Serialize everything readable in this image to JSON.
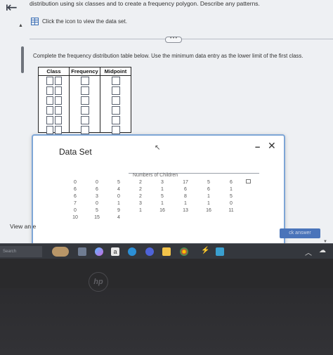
{
  "header": {
    "question_text": "distribution using six classes and to create a frequency polygon. Describe any patterns.",
    "data_link_label": "Click the icon to view the data set."
  },
  "main": {
    "instructions": "Complete the frequency distribution table below. Use the minimum data entry as the lower limit of the first class.",
    "table_headers": [
      "Class",
      "Frequency",
      "Midpoint"
    ]
  },
  "dialog": {
    "title": "Data Set",
    "minimize_label": "–",
    "close_label": "✕",
    "data_header": "Numbers of Children",
    "rows": [
      [
        "0",
        "0",
        "5",
        "2",
        "3",
        "17",
        "5",
        "6"
      ],
      [
        "6",
        "6",
        "4",
        "2",
        "1",
        "6",
        "6",
        "1"
      ],
      [
        "6",
        "3",
        "0",
        "2",
        "5",
        "8",
        "1",
        "5"
      ],
      [
        "7",
        "0",
        "1",
        "3",
        "1",
        "1",
        "1",
        "0"
      ],
      [
        "0",
        "5",
        "9",
        "1",
        "16",
        "13",
        "16",
        "11"
      ],
      [
        "10",
        "15",
        "4",
        "",
        "",
        "",
        "",
        ""
      ]
    ]
  },
  "footer": {
    "view_text": "View an e",
    "answers_button": "ck answer"
  },
  "taskbar": {
    "search_placeholder": "Search"
  },
  "icons": [
    "back-arrow-icon",
    "grid-icon",
    "cursor-icon",
    "copy-icon",
    "hp-logo"
  ],
  "colors": {
    "accent": "#4a74ba",
    "dialog_border": "#7ea6d6",
    "screen_bg": "#eef0f3"
  }
}
